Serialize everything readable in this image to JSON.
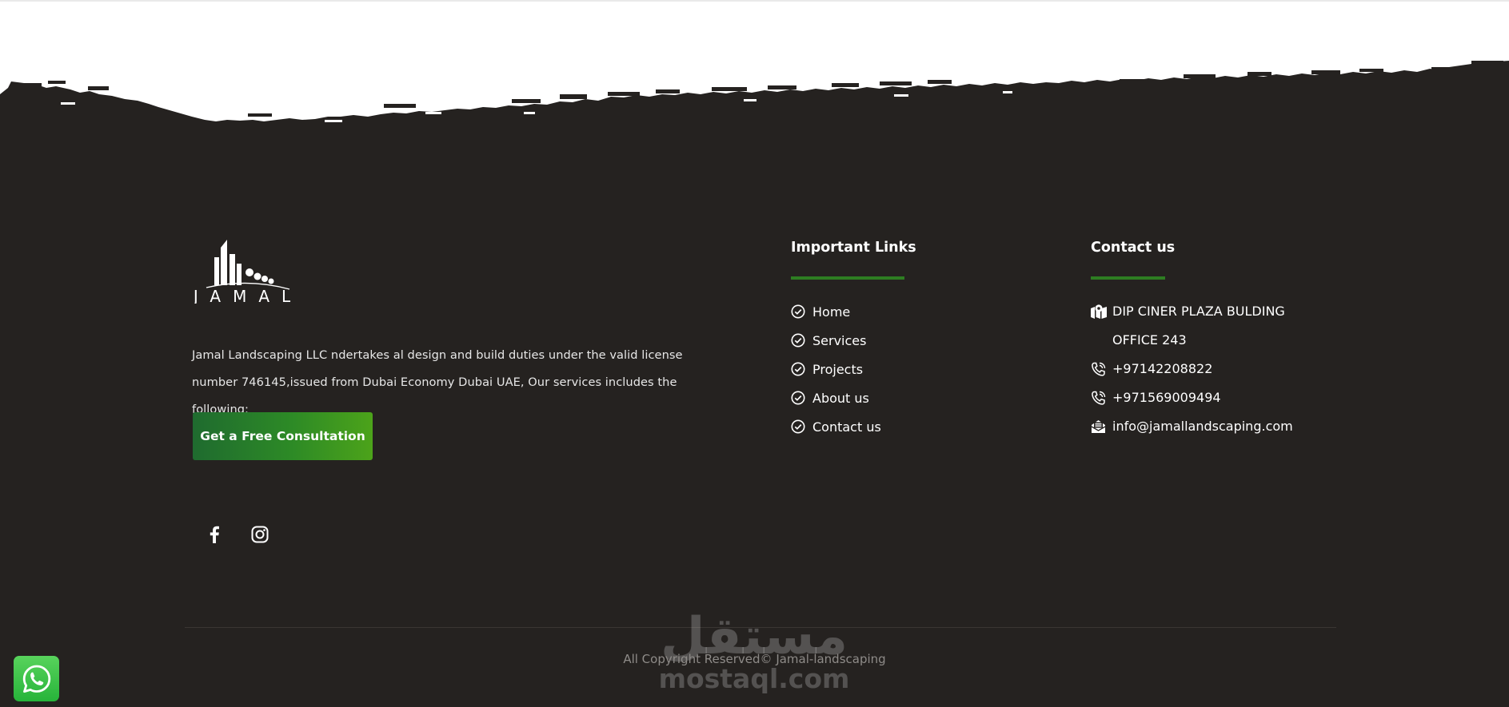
{
  "footer": {
    "brand_name": "JAMAL",
    "description": "Jamal Landscaping LLC ndertakes al design and build duties under the valid license number 746145,issued from Dubai Economy Dubai UAE, Our services includes the following:",
    "cta_label": "Get a Free Consultation",
    "social": [
      {
        "icon": "facebook-icon"
      },
      {
        "icon": "instagram-icon"
      }
    ],
    "links_title": "Important Links",
    "links": [
      {
        "label": "Home",
        "icon": "check-circle-icon"
      },
      {
        "label": "Services",
        "icon": "check-circle-icon"
      },
      {
        "label": "Projects",
        "icon": "check-circle-icon"
      },
      {
        "label": "About us",
        "icon": "check-circle-icon"
      },
      {
        "label": "Contact us",
        "icon": "check-circle-icon"
      }
    ],
    "contact_title": "Contact us",
    "contact": {
      "address": "DIP CINER PLAZA BULDING OFFICE 243",
      "phone_1": "+97142208822",
      "phone_2": "+971569009494",
      "email": "info@jamallandscaping.com"
    },
    "copyright": "All Copyright Reserved© Jamal-landscaping"
  },
  "watermark": {
    "arabic": "مستقل",
    "latin": "mostaql.com"
  },
  "colors": {
    "footer_bg": "#252220",
    "accent_green": "#2e7d22",
    "cta_gradient_start": "#1f6b2f",
    "cta_gradient_end": "#4ca31a",
    "whatsapp_green": "#3cc14a"
  },
  "whatsapp": {
    "icon": "whatsapp-icon"
  }
}
